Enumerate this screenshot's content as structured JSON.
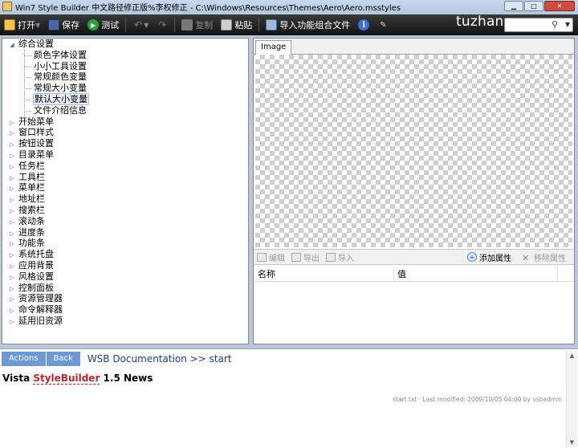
{
  "window": {
    "title": "Win7 Style Builder 中文路径修正版%李权修正 - C:\\Windows\\Resources\\Themes\\Aero\\Aero.msstyles"
  },
  "toolbar": {
    "open_label": "打开",
    "save_label": "保存",
    "test_label": "测试",
    "copy_label": "复制",
    "paste_label": "粘贴",
    "import_label": "导入功能组合文件"
  },
  "watermark": "tuzhan.com",
  "tree": {
    "root_expanded": {
      "label": "综合设置",
      "children": [
        "颜色字体设置",
        "小小工具设置",
        "常规颜色变量",
        "常规大小变量",
        "默认大小变量",
        "文件介绍信息"
      ],
      "selected_child": "默认大小变量"
    },
    "roots": [
      "开始菜单",
      "窗口样式",
      "按钮设置",
      "目录菜单",
      "任务栏",
      "工具栏",
      "菜单栏",
      "地址栏",
      "搜索栏",
      "滚动条",
      "进度条",
      "功能条",
      "系统托盘",
      "应用背景",
      "风格设置",
      "控制面板",
      "资源管理器",
      "命令解释器",
      "延用旧资源"
    ]
  },
  "preview": {
    "tab_label": "Image"
  },
  "properties": {
    "edit_label": "编辑",
    "export_label": "导出",
    "import_label": "导入",
    "add_label": "添加属性",
    "remove_label": "移除属性",
    "columns": [
      "名称",
      "值"
    ]
  },
  "docs": {
    "actions_label": "Actions",
    "back_label": "Back",
    "breadcrumb": "WSB Documentation >> start",
    "news_prefix": "Vista ",
    "news_brand": "StyleBuilder",
    "news_suffix": " 1.5 News",
    "modified": "start.txt · Last modified: 2009/10/05 04:00 by vsbadmin"
  }
}
